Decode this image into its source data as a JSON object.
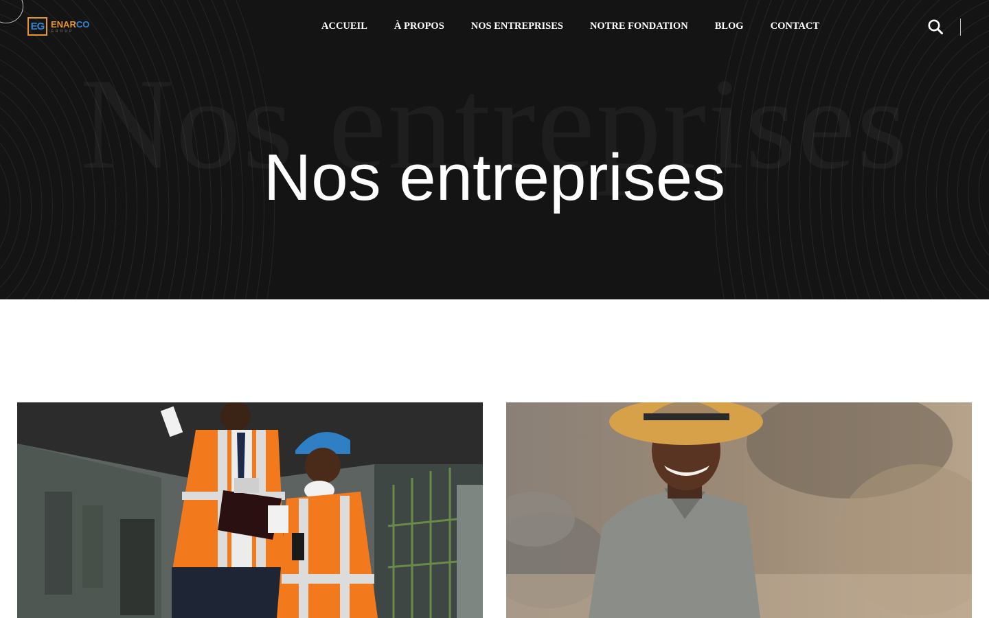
{
  "header": {
    "logo": {
      "mark": "EG",
      "name_part_1": "ENAR",
      "name_part_2": "CO",
      "subtitle": "GROUP"
    },
    "nav": [
      {
        "label": "ACCUEIL"
      },
      {
        "label": "À PROPOS"
      },
      {
        "label": "NOS ENTREPRISES"
      },
      {
        "label": "NOTRE FONDATION"
      },
      {
        "label": "BLOG"
      },
      {
        "label": "CONTACT"
      }
    ],
    "search_icon": "search-icon"
  },
  "hero": {
    "watermark": "Nos entreprises",
    "title": "Nos entreprises"
  },
  "cards": [
    {
      "image": "construction-workers-photo"
    },
    {
      "image": "smiling-man-hat-photo"
    }
  ],
  "colors": {
    "hero_bg": "#141414",
    "logo_orange": "#e8952a",
    "logo_blue": "#2f86d6",
    "vest_orange": "#f27a1d"
  }
}
